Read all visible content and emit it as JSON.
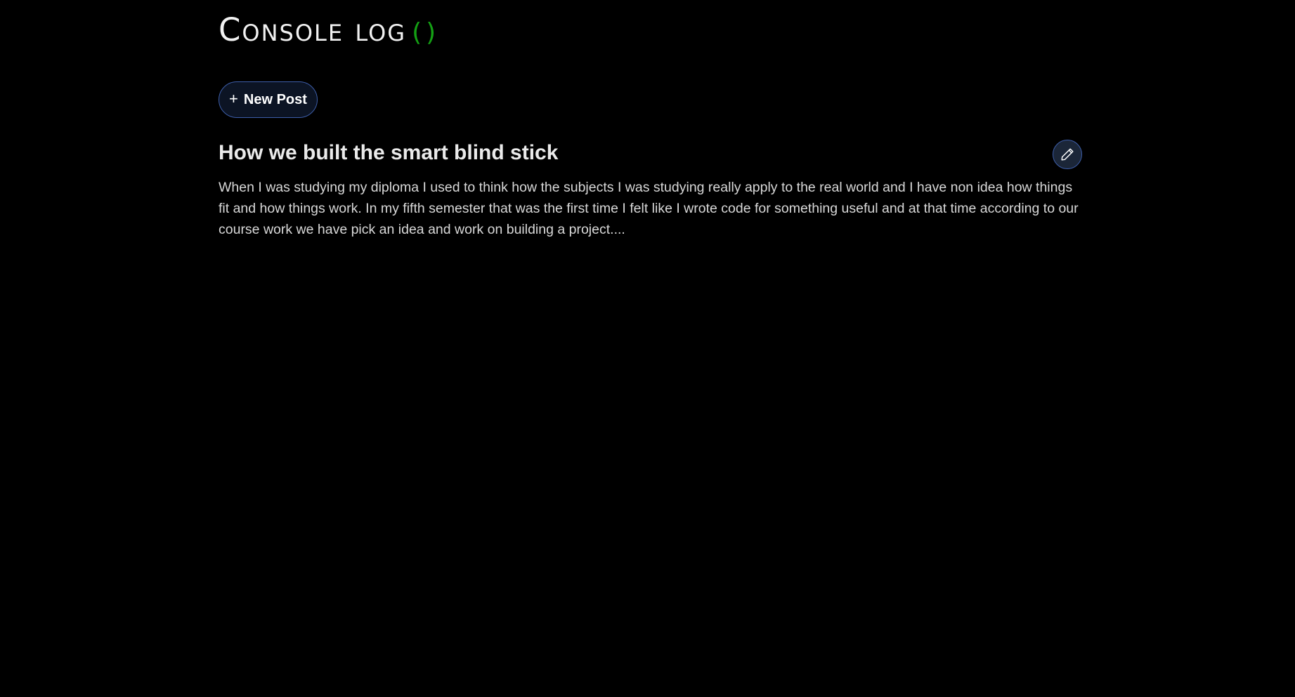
{
  "brand": {
    "title": "Console log",
    "parens": "()"
  },
  "toolbar": {
    "new_post_label": "New Post",
    "new_post_icon": "plus-icon"
  },
  "post": {
    "title": "How we built the smart blind stick",
    "excerpt": "When I was studying my diploma I used to think how the subjects I was studying really apply to the real world and I have non idea how things fit and how things work. In my fifth semester that was the first time I felt like I wrote code for something useful and at that time according to our course work we have pick an idea and work on building a project....",
    "edit_icon": "pencil-icon"
  },
  "colors": {
    "background": "#000000",
    "accent_green": "#14a014",
    "button_border": "#3d5eaa"
  }
}
